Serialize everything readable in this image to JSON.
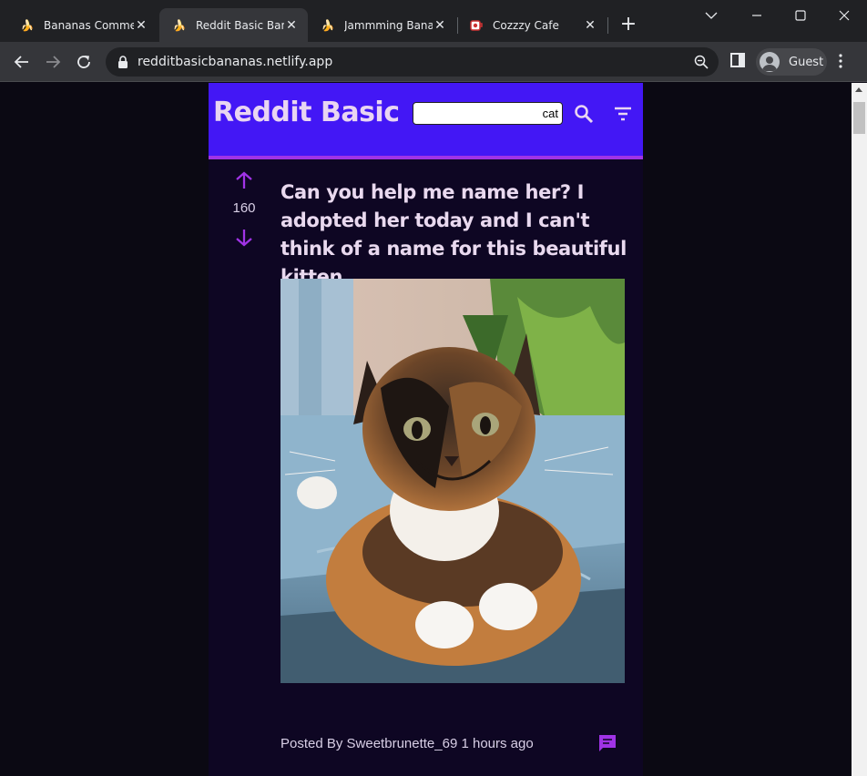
{
  "browser": {
    "tabs": [
      {
        "title": "Bananas Commen",
        "favicon": "banana-icon",
        "active": false
      },
      {
        "title": "Reddit Basic Bana",
        "favicon": "banana-icon",
        "active": true
      },
      {
        "title": "Jammming Banan",
        "favicon": "banana-icon",
        "active": false
      },
      {
        "title": "Cozzzy Cafe",
        "favicon": "cafe-icon",
        "active": false
      }
    ],
    "url": "redditbasicbananas.netlify.app",
    "profile_label": "Guest"
  },
  "app": {
    "brand": "Reddit Basic",
    "search_value": "cat",
    "post": {
      "votes": "160",
      "title": "Can you help me name her? I adopted her today and I can't think of a name for this beautiful kitten.",
      "meta": "Posted By Sweetbrunette_69 1 hours ago"
    }
  },
  "colors": {
    "header_bg": "#4317f5",
    "header_border": "#a033e6",
    "accent_purple": "#a033e6",
    "page_bg": "#0e0623"
  }
}
